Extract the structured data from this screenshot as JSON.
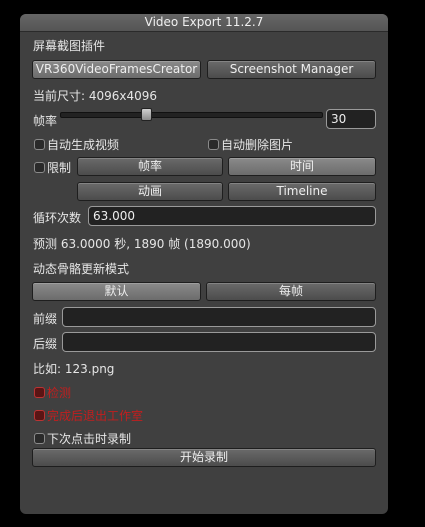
{
  "window": {
    "title": "Video Export 11.2.7"
  },
  "plugins": {
    "label": "屏幕截图插件",
    "selected": "VR360VideoFramesCreator",
    "manager_button": "Screenshot Manager"
  },
  "size": {
    "label": "当前尺寸: 4096x4096"
  },
  "framerate": {
    "label": "帧率",
    "value": "30",
    "slider_fraction": 0.33
  },
  "auto_generate": {
    "label": "自动生成视频"
  },
  "auto_delete": {
    "label": "自动删除图片"
  },
  "limit": {
    "label": "限制",
    "modes": [
      "帧率",
      "时间",
      "动画",
      "Timeline"
    ],
    "selected": "时间"
  },
  "loops": {
    "label": "循环次数",
    "value": "63.000"
  },
  "estimate": {
    "text": "预测 63.0000 秒, 1890 帧 (1890.000)"
  },
  "bone_mode": {
    "label": "动态骨骼更新模式",
    "options": [
      "默认",
      "每帧"
    ],
    "selected": "默认"
  },
  "prefix": {
    "label": "前缀",
    "value": ""
  },
  "suffix": {
    "label": "后缀",
    "value": ""
  },
  "example": {
    "text": "比如: 123.png"
  },
  "option_red1": {
    "label": "检测"
  },
  "option_red2": {
    "label": "完成后退出工作室"
  },
  "record_next_click": {
    "label": "下次点击时录制"
  },
  "start_button": {
    "label": "开始录制"
  },
  "colors": {
    "window_bg": "#404040",
    "warning_red": "#c21e1e"
  }
}
